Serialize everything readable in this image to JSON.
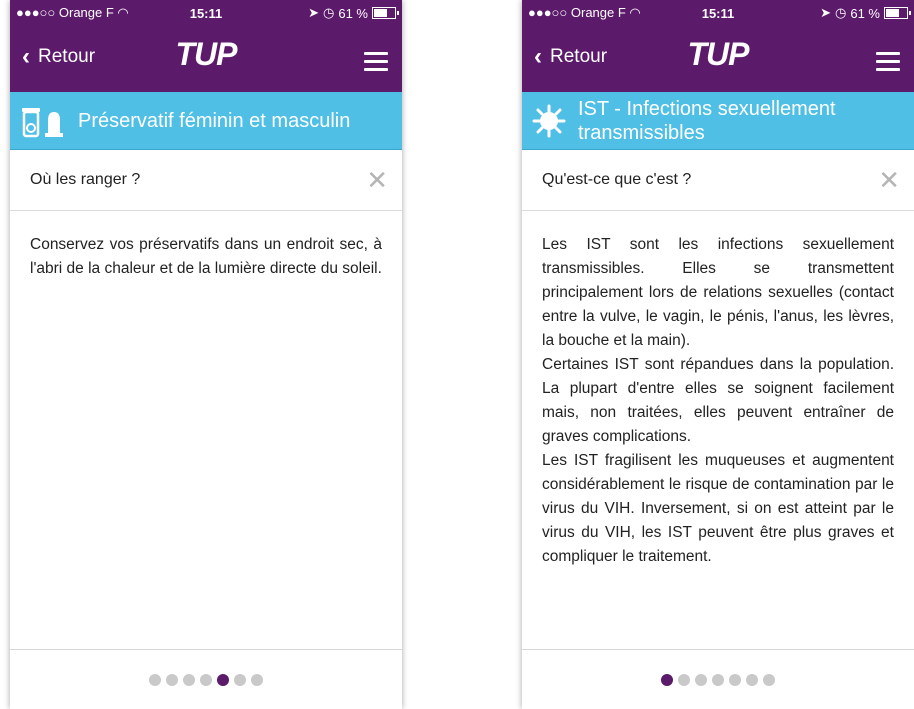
{
  "colors": {
    "purple": "#5c1a6b",
    "banner": "#4fbfe5",
    "dot_inactive": "#c9c9c9"
  },
  "screens": [
    {
      "status": {
        "carrier": "●●●○○ Orange F ",
        "time": "15:11",
        "battery": "61 %"
      },
      "nav": {
        "back_label": "Retour",
        "logo": "TUP"
      },
      "banner": {
        "title": "Préservatif féminin et masculin",
        "icon": "condom-icon"
      },
      "question": "Où les ranger ?",
      "paragraphs": [
        "Conservez vos préservatifs dans un endroit sec, à l'abri de la chaleur et de la lumière directe du soleil."
      ],
      "pager": {
        "count": 7,
        "active_index": 4
      }
    },
    {
      "status": {
        "carrier": "●●●○○ Orange F ",
        "time": "15:11",
        "battery": "61 %"
      },
      "nav": {
        "back_label": "Retour",
        "logo": "TUP"
      },
      "banner": {
        "title": "IST - Infections sexuellement transmissibles",
        "icon": "virus-icon"
      },
      "question": "Qu'est-ce que c'est ?",
      "paragraphs": [
        "Les IST sont les infections sexuellement transmissibles. Elles se transmettent principalement lors de relations sexuelles (contact entre la vulve, le vagin, le pénis, l'anus, les lèvres, la bouche et la main).",
        "Certaines IST sont répandues dans la population. La plupart d'entre elles se soignent facilement mais, non traitées, elles peuvent entraîner de graves complications.",
        "Les IST fragilisent les muqueuses et augmentent considérablement le risque de contamination par le virus du VIH. Inversement, si on est atteint par le virus du VIH, les IST peuvent être plus graves et compliquer le traitement."
      ],
      "pager": {
        "count": 7,
        "active_index": 0
      }
    }
  ]
}
